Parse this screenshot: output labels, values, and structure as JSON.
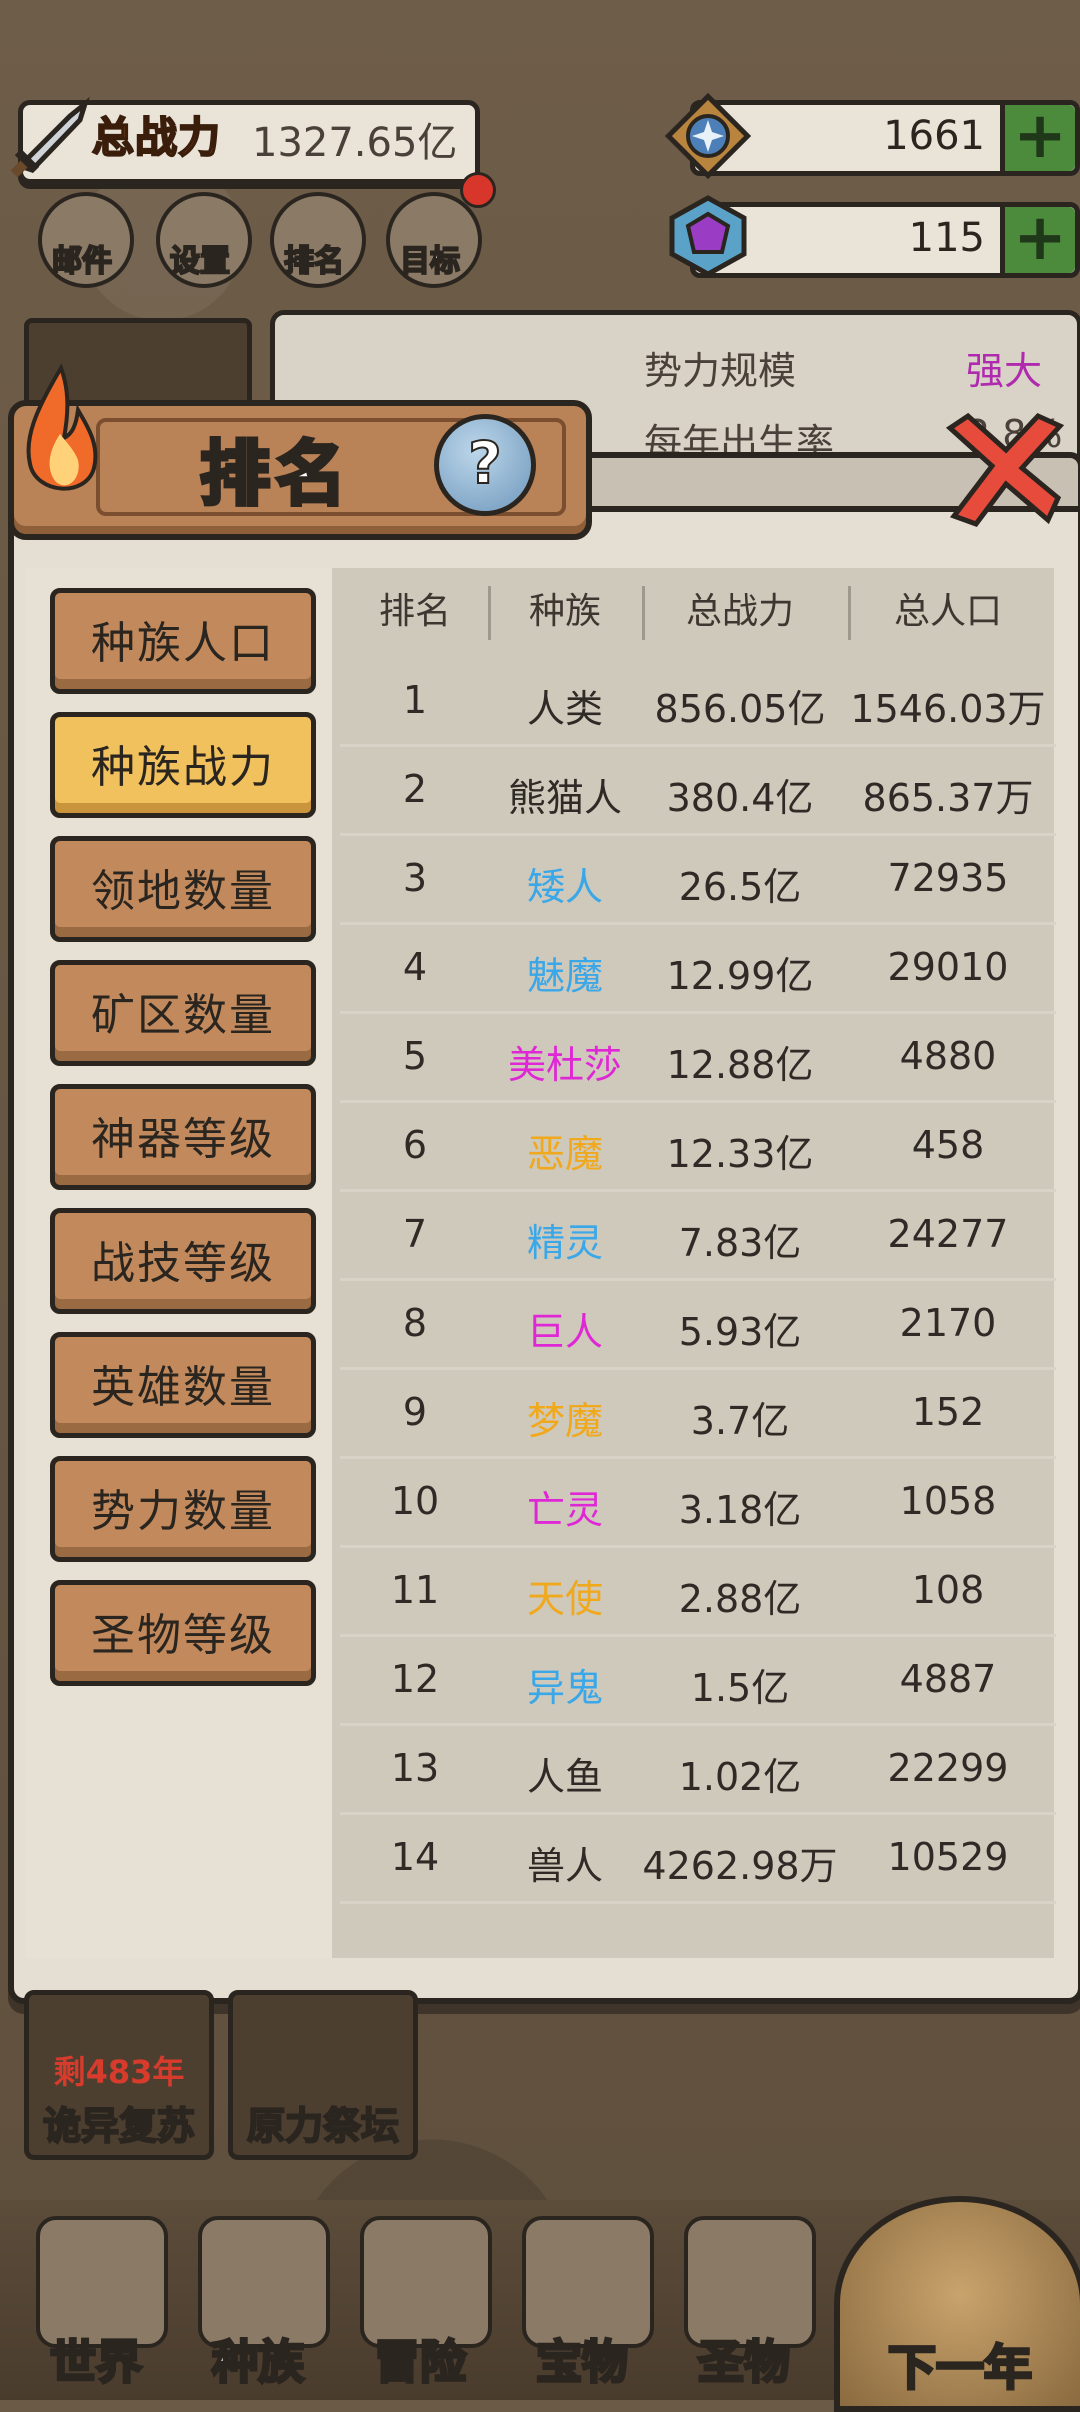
{
  "header": {
    "power_label": "总战力",
    "power_value": "1327.65亿",
    "resources": [
      {
        "name": "diamond-gem-icon",
        "value": "1661",
        "plus": "+"
      },
      {
        "name": "purple-gem-icon",
        "value": "115",
        "plus": "+"
      }
    ],
    "buttons": [
      {
        "id": "mail",
        "label": "邮件",
        "icon": "envelope-icon"
      },
      {
        "id": "settings",
        "label": "设置",
        "icon": "gear-icon"
      },
      {
        "id": "ranking",
        "label": "排名",
        "icon": "trophy-icon"
      },
      {
        "id": "goals",
        "label": "目标",
        "icon": "scroll-icon"
      }
    ]
  },
  "info_card": {
    "row1_label": "势力规模",
    "row1_value": "强大",
    "row2_label": "每年出生率",
    "row2_value": "2.8%"
  },
  "modal": {
    "title": "排名",
    "help": "?",
    "categories": [
      {
        "label": "种族人口",
        "active": false
      },
      {
        "label": "种族战力",
        "active": true
      },
      {
        "label": "领地数量",
        "active": false
      },
      {
        "label": "矿区数量",
        "active": false
      },
      {
        "label": "神器等级",
        "active": false
      },
      {
        "label": "战技等级",
        "active": false
      },
      {
        "label": "英雄数量",
        "active": false
      },
      {
        "label": "势力数量",
        "active": false
      },
      {
        "label": "圣物等级",
        "active": false
      }
    ],
    "table": {
      "headers": [
        "排名",
        "种族",
        "总战力",
        "总人口"
      ],
      "rows": [
        {
          "rank": "1",
          "race": "人类",
          "power": "856.05亿",
          "population": "1546.03万",
          "color": "#2f2a26"
        },
        {
          "rank": "2",
          "race": "熊猫人",
          "power": "380.4亿",
          "population": "865.37万",
          "color": "#2f2a26"
        },
        {
          "rank": "3",
          "race": "矮人",
          "power": "26.5亿",
          "population": "72935",
          "color": "#3aa7e8"
        },
        {
          "rank": "4",
          "race": "魅魔",
          "power": "12.99亿",
          "population": "29010",
          "color": "#3aa7e8"
        },
        {
          "rank": "5",
          "race": "美杜莎",
          "power": "12.88亿",
          "population": "4880",
          "color": "#e027d6"
        },
        {
          "rank": "6",
          "race": "恶魔",
          "power": "12.33亿",
          "population": "458",
          "color": "#f0a81c"
        },
        {
          "rank": "7",
          "race": "精灵",
          "power": "7.83亿",
          "population": "24277",
          "color": "#3aa7e8"
        },
        {
          "rank": "8",
          "race": "巨人",
          "power": "5.93亿",
          "population": "2170",
          "color": "#e027d6"
        },
        {
          "rank": "9",
          "race": "梦魔",
          "power": "3.7亿",
          "population": "152",
          "color": "#f0a81c"
        },
        {
          "rank": "10",
          "race": "亡灵",
          "power": "3.18亿",
          "population": "1058",
          "color": "#e027d6"
        },
        {
          "rank": "11",
          "race": "天使",
          "power": "2.88亿",
          "population": "108",
          "color": "#f0a81c"
        },
        {
          "rank": "12",
          "race": "异鬼",
          "power": "1.5亿",
          "population": "4887",
          "color": "#3aa7e8"
        },
        {
          "rank": "13",
          "race": "人鱼",
          "power": "1.02亿",
          "population": "22299",
          "color": "#2f2a26"
        },
        {
          "rank": "14",
          "race": "兽人",
          "power": "4262.98万",
          "population": "10529",
          "color": "#2f2a26"
        }
      ]
    }
  },
  "tiles": [
    {
      "sub": "剩483年",
      "label": "诡异复苏"
    },
    {
      "sub": "",
      "label": "原力祭坛"
    }
  ],
  "bottom_nav": [
    {
      "label": "世界",
      "icon": "world-icon"
    },
    {
      "label": "种族",
      "icon": "race-icon"
    },
    {
      "label": "冒险",
      "icon": "adventure-icon"
    },
    {
      "label": "宝物",
      "icon": "treasure-icon"
    },
    {
      "label": "圣物",
      "icon": "relic-icon"
    }
  ],
  "next_year": "下一年"
}
